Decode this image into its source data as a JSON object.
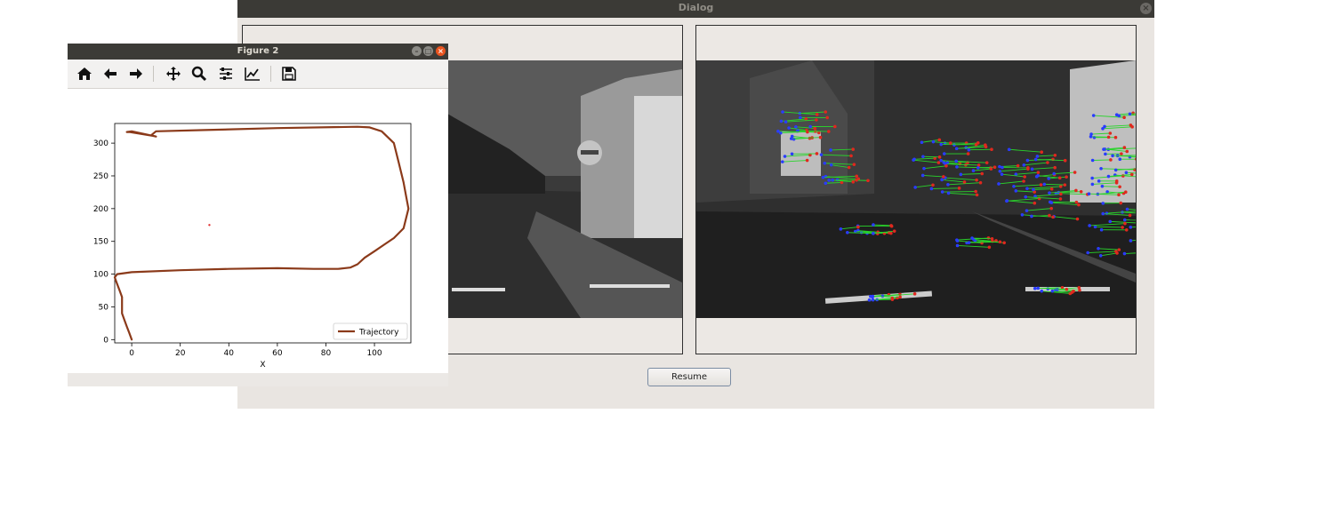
{
  "dialog": {
    "title": "Dialog",
    "close_icon": "close-icon",
    "resume_label": "Resume"
  },
  "figure": {
    "title": "Figure 2",
    "toolbar": [
      "home-icon",
      "back-icon",
      "forward-icon",
      "pan-icon",
      "zoom-icon",
      "configure-subplots-icon",
      "edit-axis-icon",
      "save-icon"
    ]
  },
  "chart_data": {
    "type": "line",
    "title": "",
    "xlabel": "X",
    "ylabel": "",
    "xlim": [
      -7,
      115
    ],
    "ylim": [
      -5,
      330
    ],
    "xticks": [
      0,
      20,
      40,
      60,
      80,
      100
    ],
    "yticks": [
      0,
      50,
      100,
      150,
      200,
      250,
      300
    ],
    "legend": "lower-right",
    "grid": false,
    "series": [
      {
        "name": "Trajectory",
        "color": "#8b3a1a",
        "x": [
          0,
          -1,
          -2,
          -3,
          -4,
          -4,
          -4,
          -5,
          -6,
          -7,
          -6,
          0,
          20,
          40,
          60,
          75,
          85,
          90,
          93,
          96,
          100,
          104,
          108,
          112,
          114,
          113,
          112,
          110,
          108,
          103,
          98,
          93,
          60,
          30,
          10,
          8,
          10,
          0,
          -2,
          -1,
          9
        ],
        "y": [
          0,
          10,
          20,
          30,
          40,
          55,
          65,
          75,
          85,
          95,
          100,
          103,
          106,
          108,
          109,
          108,
          108,
          110,
          115,
          125,
          135,
          145,
          155,
          170,
          200,
          220,
          240,
          270,
          300,
          318,
          324,
          325,
          323,
          320,
          318,
          312,
          310,
          318,
          317,
          317,
          311
        ]
      }
    ],
    "annotations": [
      {
        "x": 32,
        "y": 175,
        "type": "marker",
        "color": "#e03030"
      }
    ]
  }
}
